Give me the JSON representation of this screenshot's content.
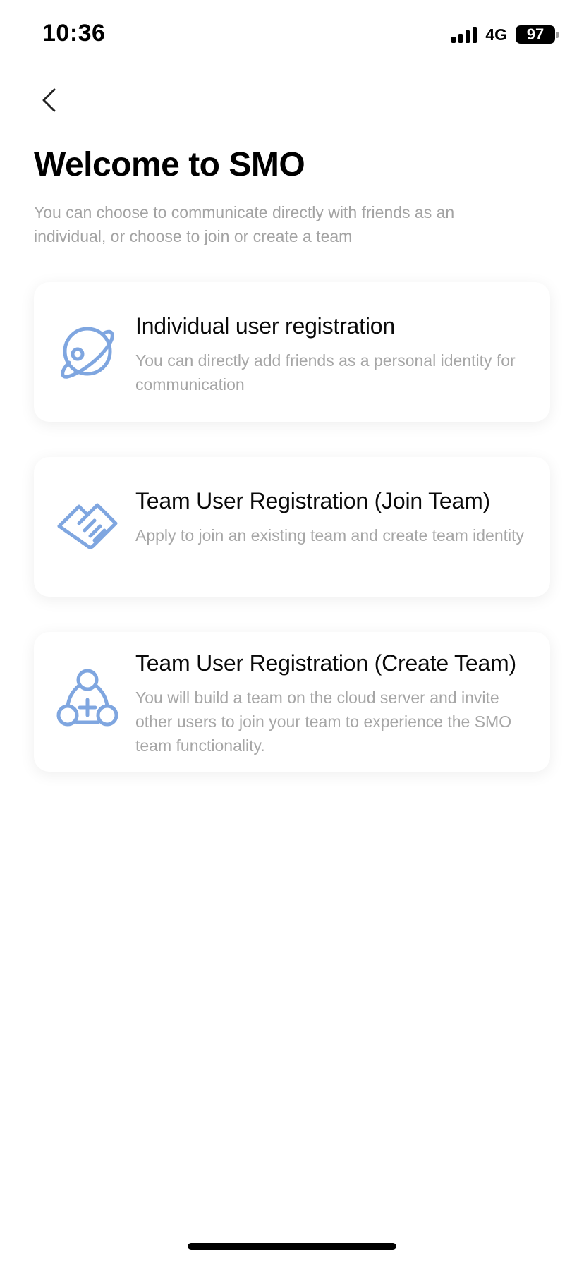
{
  "status_bar": {
    "time": "10:36",
    "network": "4G",
    "battery": "97"
  },
  "header": {
    "title": "Welcome to SMO",
    "subtitle": "You can choose to communicate directly with friends as an individual, or choose to join or create a team"
  },
  "options": [
    {
      "title": "Individual user registration",
      "description": "You can directly add friends as a personal identity for communication",
      "icon": "planet-icon"
    },
    {
      "title": "Team User Registration (Join Team)",
      "description": "Apply to join an existing team and create team identity",
      "icon": "handshake-icon"
    },
    {
      "title": "Team User Registration (Create Team)",
      "description": "You will build a team on the cloud server and invite other users to join your team to experience the SMO team functionality.",
      "icon": "team-add-icon"
    }
  ],
  "colors": {
    "icon_accent": "#7fa6e0",
    "subtitle_text": "#a3a3a3",
    "background": "#ffffff"
  }
}
